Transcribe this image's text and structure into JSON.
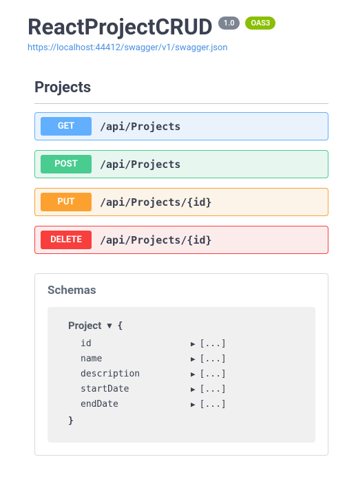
{
  "header": {
    "title": "ReactProjectCRUD",
    "version": "1.0",
    "oas": "OAS3",
    "spec_url": "https://localhost:44412/swagger/v1/swagger.json"
  },
  "tag": "Projects",
  "operations": [
    {
      "method": "GET",
      "path": "/api/Projects",
      "method_class": "get"
    },
    {
      "method": "POST",
      "path": "/api/Projects",
      "method_class": "post"
    },
    {
      "method": "PUT",
      "path": "/api/Projects/{id}",
      "method_class": "put"
    },
    {
      "method": "DELETE",
      "path": "/api/Projects/{id}",
      "method_class": "delete"
    }
  ],
  "schemas": {
    "header": "Schemas",
    "model": {
      "name": "Project",
      "open_brace": "{",
      "close_brace": "}",
      "collapsed_placeholder": "[...]",
      "properties": [
        {
          "name": "id"
        },
        {
          "name": "name"
        },
        {
          "name": "description"
        },
        {
          "name": "startDate"
        },
        {
          "name": "endDate"
        }
      ]
    }
  }
}
